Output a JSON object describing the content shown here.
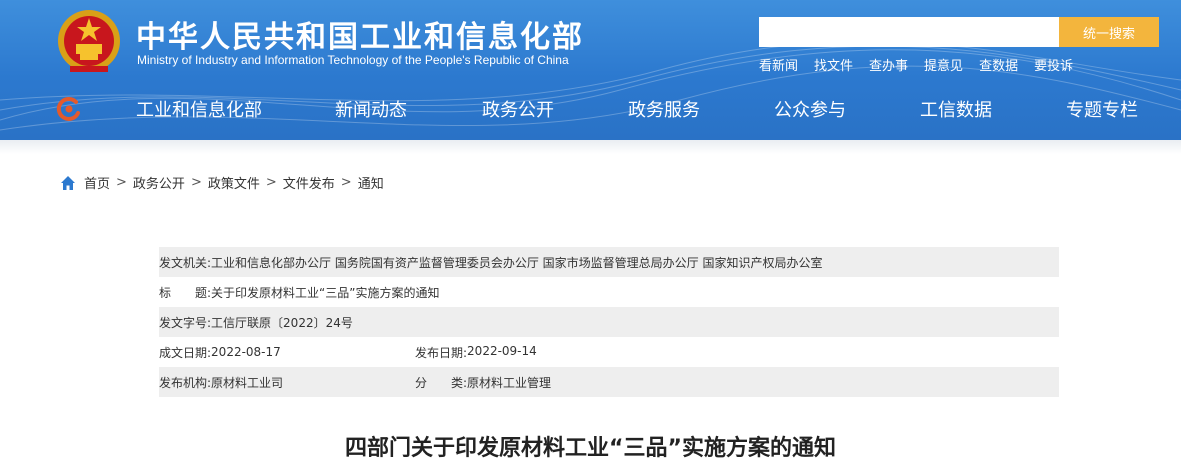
{
  "header": {
    "title": "中华人民共和国工业和信息化部",
    "subtitle": "Ministry of Industry and Information Technology of the People's Republic of China",
    "search": {
      "placeholder": "",
      "button_label": "统一搜索"
    },
    "quick_links": [
      "看新闻",
      "找文件",
      "查办事",
      "提意见",
      "查数据",
      "要投诉"
    ],
    "nav": [
      "工业和信息化部",
      "新闻动态",
      "政务公开",
      "政务服务",
      "公众参与",
      "工信数据",
      "专题专栏"
    ]
  },
  "breadcrumb": [
    "首页",
    "政务公开",
    "政策文件",
    "文件发布",
    "通知"
  ],
  "breadcrumb_separator": ">",
  "meta": {
    "issuer_label": "发文机关:",
    "issuer_value": "工业和信息化部办公厅 国务院国有资产监督管理委员会办公厅 国家市场监督管理总局办公厅 国家知识产权局办公室",
    "title_label": "标　　题:",
    "title_value": "关于印发原材料工业“三品”实施方案的通知",
    "doc_no_label": "发文字号:",
    "doc_no_value": "工信厅联原〔2022〕24号",
    "created_label": "成文日期:",
    "created_value": "2022-08-17",
    "published_label": "发布日期:",
    "published_value": "2022-09-14",
    "agency_label": "发布机构:",
    "agency_value": "原材料工业司",
    "category_label": "分　　类:",
    "category_value": "原材料工业管理"
  },
  "article_title": "四部门关于印发原材料工业“三品”实施方案的通知",
  "colors": {
    "header_blue": "#2c79cf",
    "search_button": "#f3b53d",
    "meta_shade": "#eeeeee"
  },
  "icons": [
    "national-emblem-icon",
    "miit-logo-icon",
    "home-icon"
  ]
}
